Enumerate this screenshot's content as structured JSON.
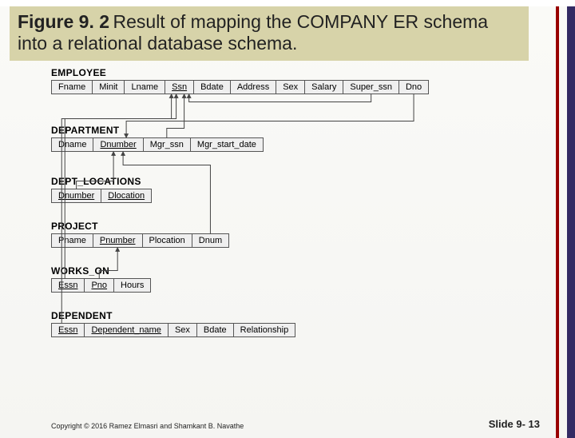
{
  "title": {
    "label": "Figure 9. 2",
    "text": "Result of mapping the COMPANY ER schema into a relational database schema."
  },
  "relations": {
    "employee": {
      "name": "EMPLOYEE",
      "cols": [
        "Fname",
        "Minit",
        "Lname",
        "Ssn",
        "Bdate",
        "Address",
        "Sex",
        "Salary",
        "Super_ssn",
        "Dno"
      ],
      "pk": [
        "Ssn"
      ]
    },
    "department": {
      "name": "DEPARTMENT",
      "cols": [
        "Dname",
        "Dnumber",
        "Mgr_ssn",
        "Mgr_start_date"
      ],
      "pk": [
        "Dnumber"
      ]
    },
    "dept_locations": {
      "name": "DEPT_LOCATIONS",
      "cols": [
        "Dnumber",
        "Dlocation"
      ],
      "pk": [
        "Dnumber",
        "Dlocation"
      ]
    },
    "project": {
      "name": "PROJECT",
      "cols": [
        "Pname",
        "Pnumber",
        "Plocation",
        "Dnum"
      ],
      "pk": [
        "Pnumber"
      ]
    },
    "works_on": {
      "name": "WORKS_ON",
      "cols": [
        "Essn",
        "Pno",
        "Hours"
      ],
      "pk": [
        "Essn",
        "Pno"
      ]
    },
    "dependent": {
      "name": "DEPENDENT",
      "cols": [
        "Essn",
        "Dependent_name",
        "Sex",
        "Bdate",
        "Relationship"
      ],
      "pk": [
        "Essn",
        "Dependent_name"
      ]
    }
  },
  "foreign_keys": [
    {
      "from": "EMPLOYEE.Super_ssn",
      "to": "EMPLOYEE.Ssn"
    },
    {
      "from": "EMPLOYEE.Dno",
      "to": "DEPARTMENT.Dnumber"
    },
    {
      "from": "DEPARTMENT.Mgr_ssn",
      "to": "EMPLOYEE.Ssn"
    },
    {
      "from": "DEPT_LOCATIONS.Dnumber",
      "to": "DEPARTMENT.Dnumber"
    },
    {
      "from": "PROJECT.Dnum",
      "to": "DEPARTMENT.Dnumber"
    },
    {
      "from": "WORKS_ON.Essn",
      "to": "EMPLOYEE.Ssn"
    },
    {
      "from": "WORKS_ON.Pno",
      "to": "PROJECT.Pnumber"
    },
    {
      "from": "DEPENDENT.Essn",
      "to": "EMPLOYEE.Ssn"
    }
  ],
  "footer": {
    "copyright": "Copyright © 2016 Ramez Elmasri and Shamkant B. Navathe",
    "slide": "Slide 9- 13"
  }
}
